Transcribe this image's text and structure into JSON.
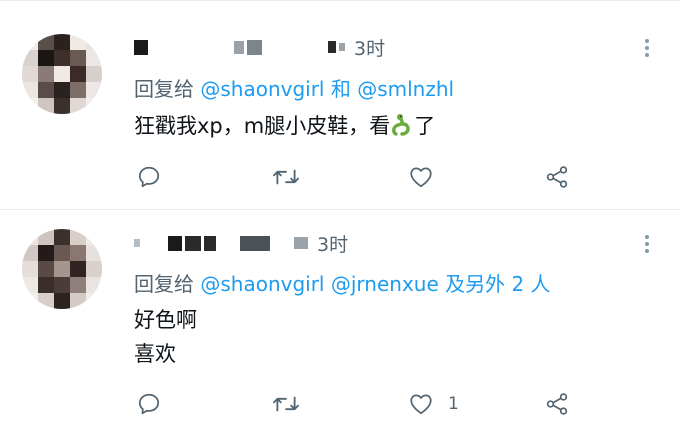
{
  "tweets": [
    {
      "time": "3时",
      "reply_prefix": "回复给",
      "mention1": "@shaonvgirl",
      "connector": " 和 ",
      "mention2": "@smlnzhl",
      "extra": "",
      "body_before_emoji": "狂戳我xp，m腿小皮鞋，看",
      "emoji": "snake-emoji",
      "body_after_emoji": "了",
      "like_count": ""
    },
    {
      "time": "3时",
      "reply_prefix": "回复给",
      "mention1": "@shaonvgirl",
      "connector": " ",
      "mention2": "@jrnenxue",
      "extra": " 及另外 2 人",
      "line1": "好色啊",
      "line2": "喜欢",
      "like_count": "1"
    }
  ],
  "icons": [
    "comment-icon",
    "retweet-icon",
    "like-icon",
    "share-icon",
    "more-icon"
  ],
  "colors": {
    "link": "#1d9bf0",
    "muted": "#536471",
    "divider": "#e6ecf0"
  }
}
